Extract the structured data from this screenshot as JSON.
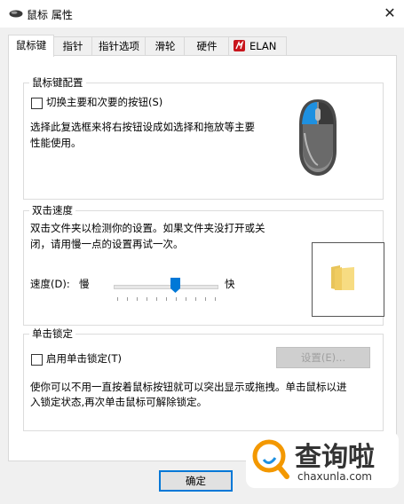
{
  "window": {
    "title": "鼠标 属性",
    "close_glyph": "✕"
  },
  "tabs": [
    {
      "label": "鼠标键",
      "active": true
    },
    {
      "label": "指针"
    },
    {
      "label": "指针选项"
    },
    {
      "label": "滑轮"
    },
    {
      "label": "硬件"
    },
    {
      "label": "ELAN"
    }
  ],
  "button_config": {
    "title": "鼠标键配置",
    "switch_label": "切换主要和次要的按钮(S)",
    "switch_checked": false,
    "description": [
      "选择此复选框来将右按钮设成如选择和拖放等主要",
      "性能使用。"
    ]
  },
  "double_click": {
    "title": "双击速度",
    "description": [
      "双击文件夹以检测你的设置。如果文件夹没打开或关",
      "闭，请用慢一点的设置再试一次。"
    ],
    "speed_label": "速度(D):",
    "slow_label": "慢",
    "fast_label": "快",
    "speed_fraction": 0.6
  },
  "click_lock": {
    "title": "单击锁定",
    "enable_label": "启用单击锁定(T)",
    "enable_checked": false,
    "settings_button": "设置(E)...",
    "description": [
      "使你可以不用一直按着鼠标按钮就可以突出显示或拖拽。单击鼠标以进",
      "入锁定状态,再次单击鼠标可解除锁定。"
    ]
  },
  "footer": {
    "ok_button": "确定"
  },
  "watermark": {
    "brand": "查询啦",
    "domain": "chaxunla.com"
  },
  "colors": {
    "accent": "#0078d7",
    "mouse_highlight": "#1e90e0",
    "watermark_orange": "#f39800"
  },
  "icons": [
    "mouse-title-icon",
    "close-icon",
    "elan-logo-icon",
    "mouse-illustration-icon",
    "folder-icon"
  ]
}
